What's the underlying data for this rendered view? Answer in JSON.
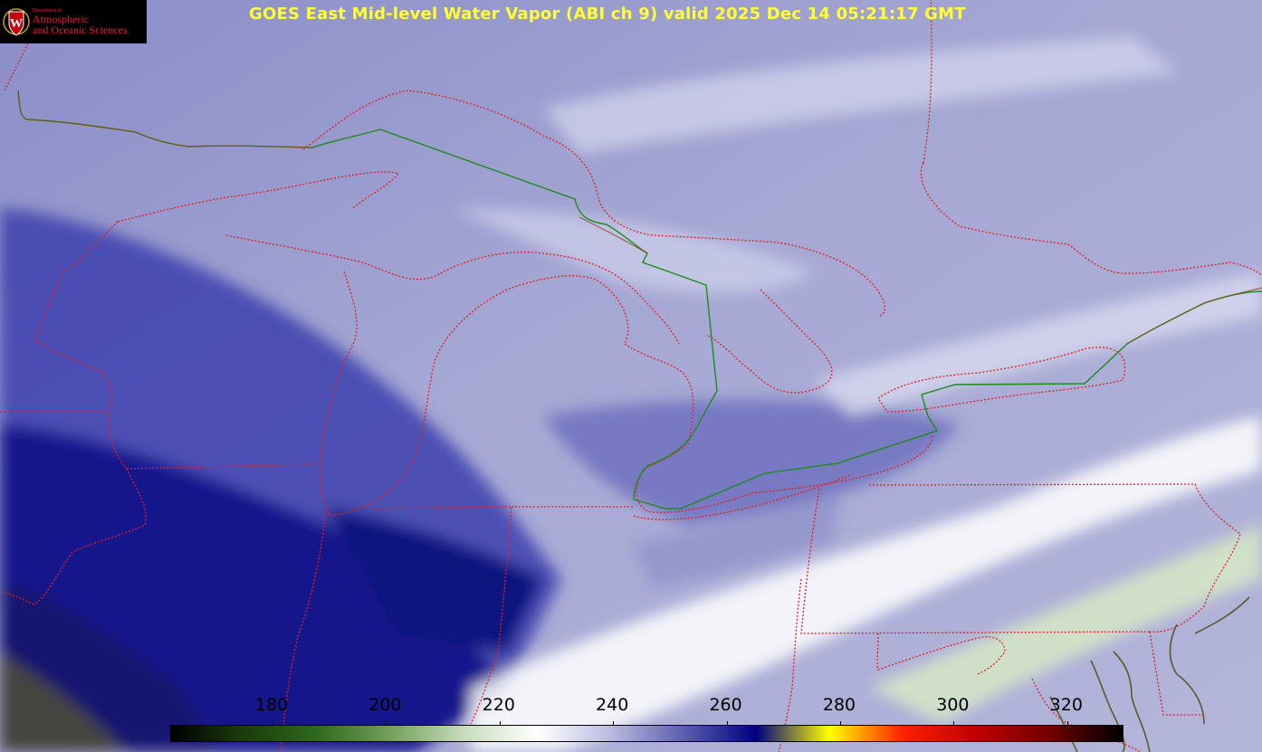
{
  "title": "GOES East Mid-level Water Vapor (ABI ch 9)  valid 2025 Dec 14 05:21:17 GMT",
  "title_color": "#ffff33",
  "logo": {
    "department": "Department of",
    "line1": "Atmospheric",
    "line2": "and Oceanic Sciences",
    "text_color": "#e0203a",
    "shield_color": "#c5050c",
    "letter": "W"
  },
  "colorbar": {
    "ticks": [
      "180",
      "200",
      "220",
      "240",
      "260",
      "280",
      "300",
      "320"
    ],
    "stops": [
      "#000000",
      "#1a3d0a",
      "#2f6a1c",
      "#73a05a",
      "#c8dcbc",
      "#ffffff",
      "#b9bbe0",
      "#5d5fae",
      "#000080",
      "#ffff00",
      "#ff2000",
      "#c00000",
      "#700000",
      "#000000"
    ]
  },
  "map": {
    "state_border_color": "#e02020",
    "international_border_color": "#1c8c1c",
    "coast_color": "#e02020"
  }
}
